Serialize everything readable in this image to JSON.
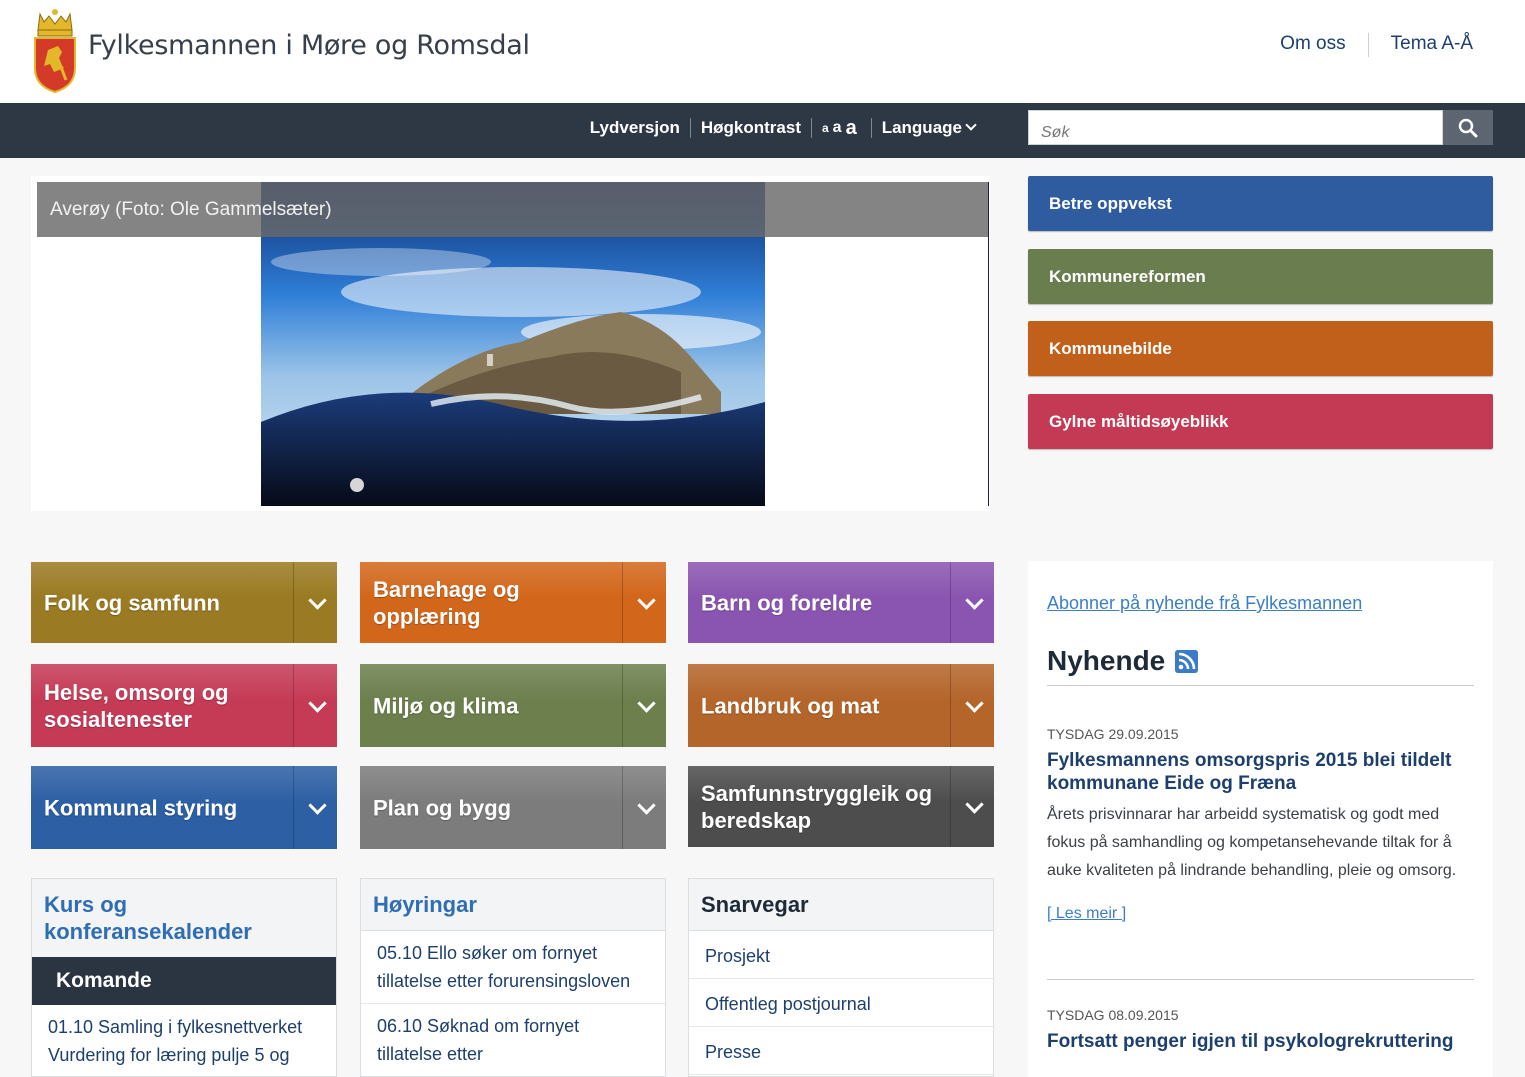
{
  "header": {
    "site_title": "Fylkesmannen i Møre og Romsdal",
    "top_links": [
      "Om oss",
      "Tema A-Å"
    ]
  },
  "toolbar": {
    "audio": "Lydversjon",
    "contrast": "Høgkontrast",
    "font_sizes": [
      "a",
      "a",
      "a"
    ],
    "language": "Language",
    "search_placeholder": "Søk",
    "search_icon": "search-icon"
  },
  "slider": {
    "caption": "Averøy (Foto: Ole Gammelsæter)"
  },
  "promos": [
    {
      "label": "Betre oppvekst",
      "color": "#2e5c9e"
    },
    {
      "label": "Kommunereformen",
      "color": "#6a7d4e"
    },
    {
      "label": "Kommunebilde",
      "color": "#c0601a"
    },
    {
      "label": "Gylne måltidsøyeblikk",
      "color": "#c43a55"
    }
  ],
  "categories": [
    {
      "label": "Folk og samfunn",
      "color": "#9a7a22"
    },
    {
      "label": "Barnehage og opplæring",
      "color": "#d2661a"
    },
    {
      "label": "Barn og foreldre",
      "color": "#8a55b0"
    },
    {
      "label": "Helse, omsorg og sosialtenester",
      "color": "#c53a55"
    },
    {
      "label": "Miljø og klima",
      "color": "#6c7f4d"
    },
    {
      "label": "Landbruk og mat",
      "color": "#b4652a"
    },
    {
      "label": "Kommunal styring",
      "color": "#2c5fa4"
    },
    {
      "label": "Plan og bygg",
      "color": "#7c7c7c"
    },
    {
      "label": "Samfunnstryggleik og beredskap",
      "color": "#4d4d4d"
    }
  ],
  "calendar": {
    "title": "Kurs og konferansekalender",
    "subtitle": "Komande",
    "items": [
      "01.10 Samling i fylkesnettverket Vurdering for læring pulje 5 og"
    ]
  },
  "hearings": {
    "title": "Høyringar",
    "items": [
      "05.10 Ello søker om fornyet tillatelse etter forurensingsloven",
      "06.10 Søknad om fornyet tillatelse etter"
    ]
  },
  "shortcuts": {
    "title": "Snarvegar",
    "items": [
      "Prosjekt",
      "Offentleg postjournal",
      "Presse"
    ]
  },
  "news": {
    "subscribe": "Abonner på nyhende frå Fylkesmannen",
    "title": "Nyhende",
    "items": [
      {
        "date": "TYSDAG 29.09.2015",
        "headline": "Fylkesmannens omsorgspris 2015 blei tildelt kommunane Eide og Fræna",
        "body": "Årets prisvinnarar har arbeidd systematisk og godt med fokus på samhandling og kompetansehevande tiltak for å auke kvaliteten på lindrande behandling, pleie og omsorg.",
        "read_more": "[ Les meir ]"
      },
      {
        "date": "TYSDAG 08.09.2015",
        "headline": "Fortsatt penger igjen til psykologrekruttering"
      }
    ]
  }
}
